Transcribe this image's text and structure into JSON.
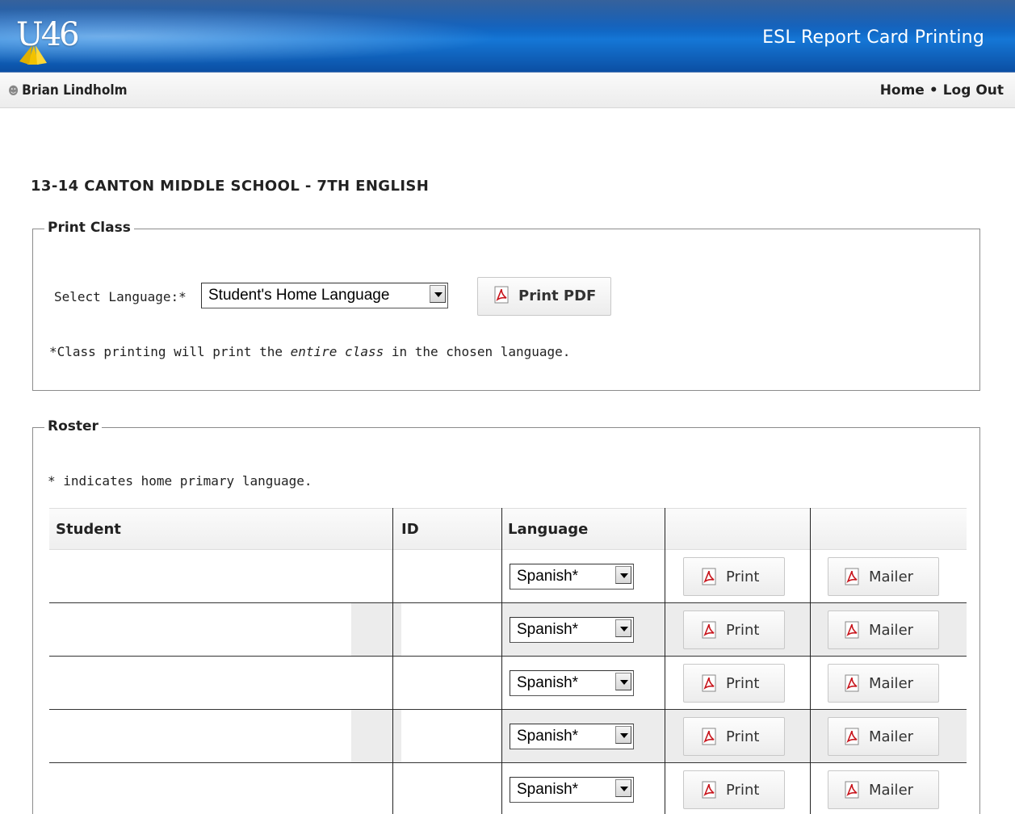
{
  "header": {
    "logo_text": "U46",
    "app_title": "ESL Report Card Printing"
  },
  "userbar": {
    "user_name": "Brian Lindholm",
    "nav_home": "Home",
    "nav_separator": "•",
    "nav_logout": "Log Out"
  },
  "page": {
    "title": "13-14 CANTON MIDDLE SCHOOL - 7TH ENGLISH"
  },
  "print_class": {
    "legend": "Print Class",
    "language_label": "Select Language:*",
    "language_selected": "Student's Home Language",
    "print_button": "Print PDF",
    "note_prefix": "*Class printing will print the ",
    "note_emphasis": "entire class",
    "note_suffix": " in the chosen language."
  },
  "roster": {
    "legend": "Roster",
    "note": "* indicates home primary language.",
    "columns": [
      "Student",
      "ID",
      "Language",
      "",
      ""
    ],
    "rows": [
      {
        "language": "Spanish*",
        "print_label": "Print",
        "mailer_label": "Mailer"
      },
      {
        "language": "Spanish*",
        "print_label": "Print",
        "mailer_label": "Mailer"
      },
      {
        "language": "Spanish*",
        "print_label": "Print",
        "mailer_label": "Mailer"
      },
      {
        "language": "Spanish*",
        "print_label": "Print",
        "mailer_label": "Mailer"
      },
      {
        "language": "Spanish*",
        "print_label": "Print",
        "mailer_label": "Mailer"
      }
    ]
  },
  "colors": {
    "banner_dark": "#0a3f86",
    "banner_light": "#1577d6",
    "pdf_red": "#c8161d",
    "row_alt": "#ececec"
  }
}
